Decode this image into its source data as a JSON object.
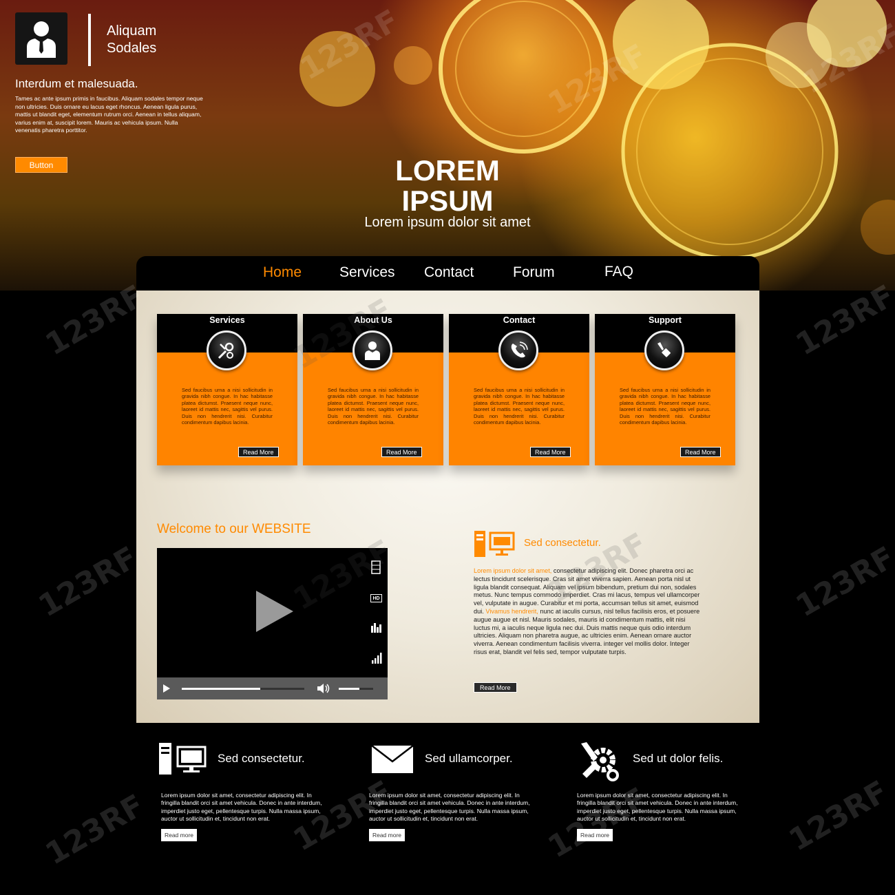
{
  "brand": {
    "line1": "Aliquam",
    "line2": "Sodales"
  },
  "hero": {
    "heading": "Interdum et malesuada.",
    "text": "Tames ac ante ipsum primis in faucibus. Aliquam sodales tempor neque non ultricies. Duis ornare eu lacus eget rhoncus. Aenean ligula purus, mattis ut blandit eget, elementum rutrum orci. Aenean in tellus aliquam, varius enim at, suscipit lorem. Mauris ac vehicula ipsum. Nulla venenatis pharetra porttitor.",
    "button": "Button",
    "title_line1": "LOREM",
    "title_line2": "IPSUM",
    "subtitle": "Lorem ipsum dolor sit amet"
  },
  "nav": {
    "items": [
      "Home",
      "Services",
      "Contact",
      "Forum",
      "FAQ"
    ],
    "active": "Home"
  },
  "cards": [
    {
      "title": "Services",
      "icon": "tools-icon",
      "text": "Sed faucibus urna a nisi sollicitudin in gravida nibh congue. In hac habitasse platea dictumst. Praesent neque nunc, laoreet id mattis nec, sagittis vel purus. Duis non hendrerit nisi. Curabitur condimentum dapibus lacinia.",
      "button": "Read More"
    },
    {
      "title": "About Us",
      "icon": "user-icon",
      "text": "Sed faucibus urna a nisi sollicitudin in gravida nibh congue. In hac habitasse platea dictumst. Praesent neque nunc, laoreet id mattis nec, sagittis vel purus. Duis non hendrerit nisi. Curabitur condimentum dapibus lacinia.",
      "button": "Read More"
    },
    {
      "title": "Contact",
      "icon": "phone-icon",
      "text": "Sed faucibus urna a nisi sollicitudin in gravida nibh congue. In hac habitasse platea dictumst. Praesent neque nunc, laoreet id mattis nec, sagittis vel purus. Duis non hendrerit nisi. Curabitur condimentum dapibus lacinia.",
      "button": "Read More"
    },
    {
      "title": "Support",
      "icon": "wrench-icon",
      "text": "Sed faucibus urna a nisi sollicitudin in gravida nibh congue. In hac habitasse platea dictumst. Praesent neque nunc, laoreet id mattis nec, sagittis vel purus. Duis non hendrerit nisi. Curabitur condimentum dapibus lacinia.",
      "button": "Read More"
    }
  ],
  "welcome": "Welcome to our WEBSITE",
  "video": {
    "hd_label": "HD"
  },
  "feature": {
    "title": "Sed consectetur.",
    "text_highlight1": "Lorem ipsum dolor sit amet,",
    "text_part1": " consectetur adipiscing elit. Donec pharetra orci ac lectus tincidunt scelerisque. Cras sit amet viverra sapien. Aenean porta nisl ut ligula blandit consequat. Aliquam vel ipsum bibendum, pretium dui non, sodales metus. Nunc tempus commodo imperdiet. Cras mi lacus, tempus vel ullamcorper vel, vulputate in augue. Curabitur et mi porta, accumsan tellus sit amet, euismod dui. ",
    "text_highlight2": "Vivamus hendrerit,",
    "text_part2": " nunc at iaculis cursus, nisl tellus facilisis eros, et posuere augue augue et nisl. Mauris sodales, mauris id condimentum mattis, elit nisi luctus mi, a iaculis neque ligula nec dui. Duis mattis neque quis odio interdum ultricies. Aliquam non pharetra augue, ac ultricies enim. Aenean ornare auctor viverra. Aenean condimentum facilisis viverra. integer vel mollis dolor. Integer risus erat, blandit vel felis sed, tempor vulputate turpis.",
    "button": "Read More"
  },
  "footer": [
    {
      "title": "Sed consectetur.",
      "icon": "computer-icon",
      "text": "Lorem ipsum dolor sit amet, consectetur adipiscing elit. In fringilla blandit orci sit amet vehicula. Donec in ante interdum, imperdiet justo eget, pellentesque turpis. Nulla massa ipsum, auctor ut sollicitudin et, tincidunt non erat.",
      "button": "Read more"
    },
    {
      "title": "Sed ullamcorper.",
      "icon": "envelope-icon",
      "text": "Lorem ipsum dolor sit amet, consectetur adipiscing elit. In fringilla blandit orci sit amet vehicula. Donec in ante interdum, imperdiet justo eget, pellentesque turpis. Nulla massa ipsum, auctor ut sollicitudin et, tincidunt non erat.",
      "button": "Read more"
    },
    {
      "title": "Sed ut dolor felis.",
      "icon": "tools-icon",
      "text": "Lorem ipsum dolor sit amet, consectetur adipiscing elit. In fringilla blandit orci sit amet vehicula. Donec in ante interdum, imperdiet justo eget, pellentesque turpis. Nulla massa ipsum, auctor ut sollicitudin et, tincidunt non erat.",
      "button": "Read more"
    }
  ],
  "watermark": "123RF",
  "colors": {
    "accent": "#ff8a00",
    "card": "#ff8400",
    "dark": "#000000"
  }
}
